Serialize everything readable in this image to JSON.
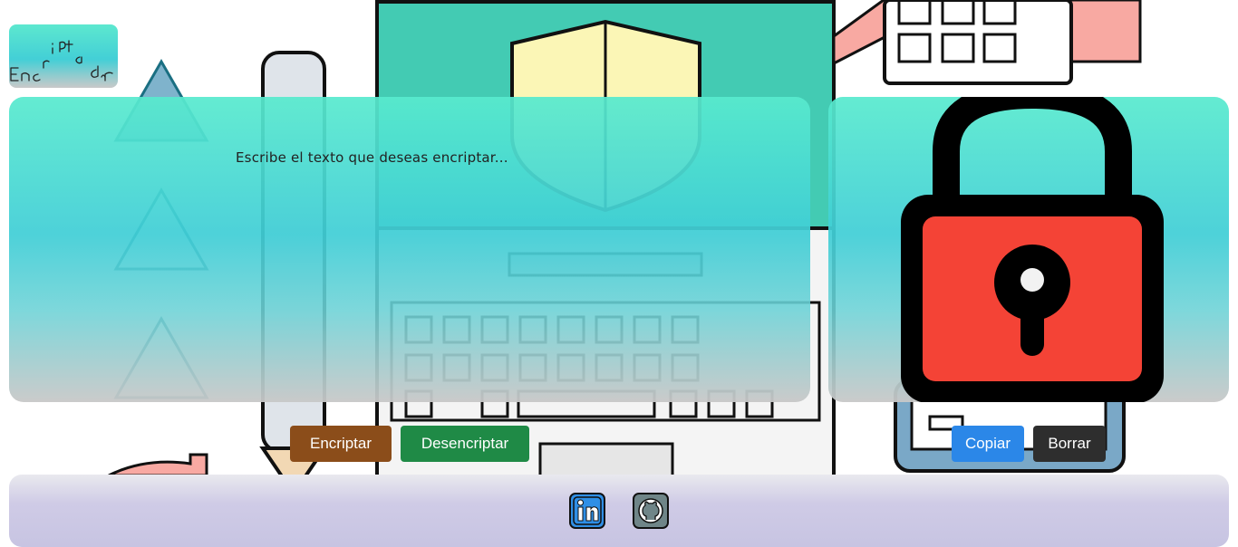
{
  "logo": {
    "text": "Encriptador"
  },
  "input": {
    "placeholder": "Escribe el texto que deseas encriptar..."
  },
  "buttons": {
    "encrypt": "Encriptar",
    "decrypt": "Desencriptar",
    "copy": "Copiar",
    "clear": "Borrar"
  },
  "output": {
    "text": ""
  },
  "footer": {
    "links": [
      {
        "name": "LinkedIn",
        "icon": "linkedin-icon",
        "color": "#2f8fe6"
      },
      {
        "name": "GitHub",
        "icon": "github-icon",
        "color": "#6f8588"
      }
    ]
  },
  "colors": {
    "panel_top": "#58eace",
    "panel_mid": "#40ced6",
    "encrypt_button": "#8b4d1a",
    "decrypt_button": "#1f8a46",
    "copy_button": "#2b87e8",
    "clear_button": "#2e2e2e",
    "lock_body": "#f44336"
  }
}
